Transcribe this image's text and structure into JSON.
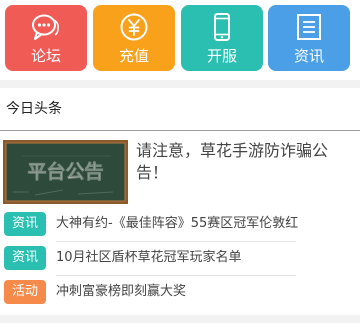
{
  "nav": {
    "items": [
      {
        "label": "论坛",
        "color": "#f05b56",
        "icon": "chat-bubbles-icon"
      },
      {
        "label": "充值",
        "color": "#f9a11b",
        "icon": "yuan-coin-icon"
      },
      {
        "label": "开服",
        "color": "#2bbfb1",
        "icon": "mobile-phone-icon"
      },
      {
        "label": "资讯",
        "color": "#4b9fe6",
        "icon": "document-list-icon"
      }
    ]
  },
  "section": {
    "title": "今日头条"
  },
  "feature": {
    "image_text": "平台公告",
    "text": "请注意，草花手游防诈骗公告！"
  },
  "news": [
    {
      "tag": "资讯",
      "tag_color": "#2bbfb1",
      "title": "大神有约-《最佳阵容》55赛区冠军伦敦红"
    },
    {
      "tag": "资讯",
      "tag_color": "#2bbfb1",
      "title": "10月社区盾杯草花冠军玩家名单"
    },
    {
      "tag": "活动",
      "tag_color": "#f58a4a",
      "title": "冲刺富豪榜即刻赢大奖"
    }
  ]
}
